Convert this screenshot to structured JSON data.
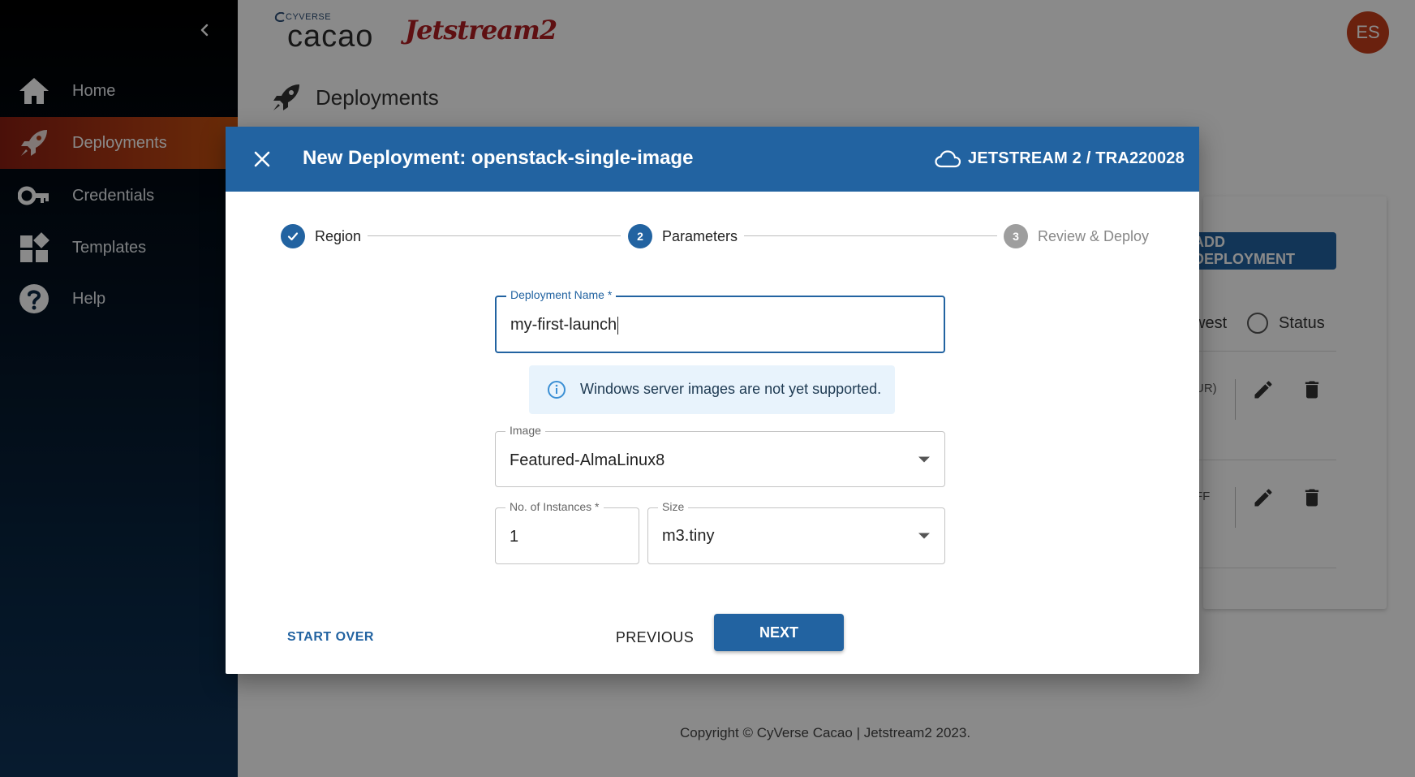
{
  "sidebar": {
    "items": [
      {
        "label": "Home",
        "icon": "home-icon"
      },
      {
        "label": "Deployments",
        "icon": "rocket-icon",
        "active": true
      },
      {
        "label": "Credentials",
        "icon": "key-icon"
      },
      {
        "label": "Templates",
        "icon": "templates-icon"
      },
      {
        "label": "Help",
        "icon": "help-icon"
      }
    ]
  },
  "header": {
    "logo_small": "CYVERSE",
    "logo_big": "cacao",
    "logo_partner": "Jetstream2",
    "avatar_initials": "ES"
  },
  "page": {
    "title": "Deployments",
    "add_button": "ADD DEPLOYMENT",
    "sort_partial": "west",
    "status_label": "Status",
    "row1_status_partial": "UR)",
    "row2_status_partial": "FF",
    "footer": "Copyright © CyVerse Cacao | Jetstream2 2023."
  },
  "dialog": {
    "title": "New Deployment: openstack-single-image",
    "cloud_label": "JETSTREAM 2 / TRA220028",
    "steps": [
      {
        "number": "",
        "label": "Region",
        "state": "complete"
      },
      {
        "number": "2",
        "label": "Parameters",
        "state": "active"
      },
      {
        "number": "3",
        "label": "Review & Deploy",
        "state": "pending"
      }
    ],
    "deployment_name": {
      "label": "Deployment Name *",
      "value": "my-first-launch"
    },
    "info_message": "Windows server images are not yet supported.",
    "image": {
      "label": "Image",
      "value": "Featured-AlmaLinux8"
    },
    "instances": {
      "label": "No. of Instances *",
      "value": "1"
    },
    "size": {
      "label": "Size",
      "value": "m3.tiny"
    },
    "start_over": "START OVER",
    "previous": "PREVIOUS",
    "next": "NEXT"
  },
  "colors": {
    "primary": "#2263a1",
    "active_nav": "#b03a14",
    "avatar": "#c53d1b",
    "info_bg": "#e8f3fc"
  }
}
